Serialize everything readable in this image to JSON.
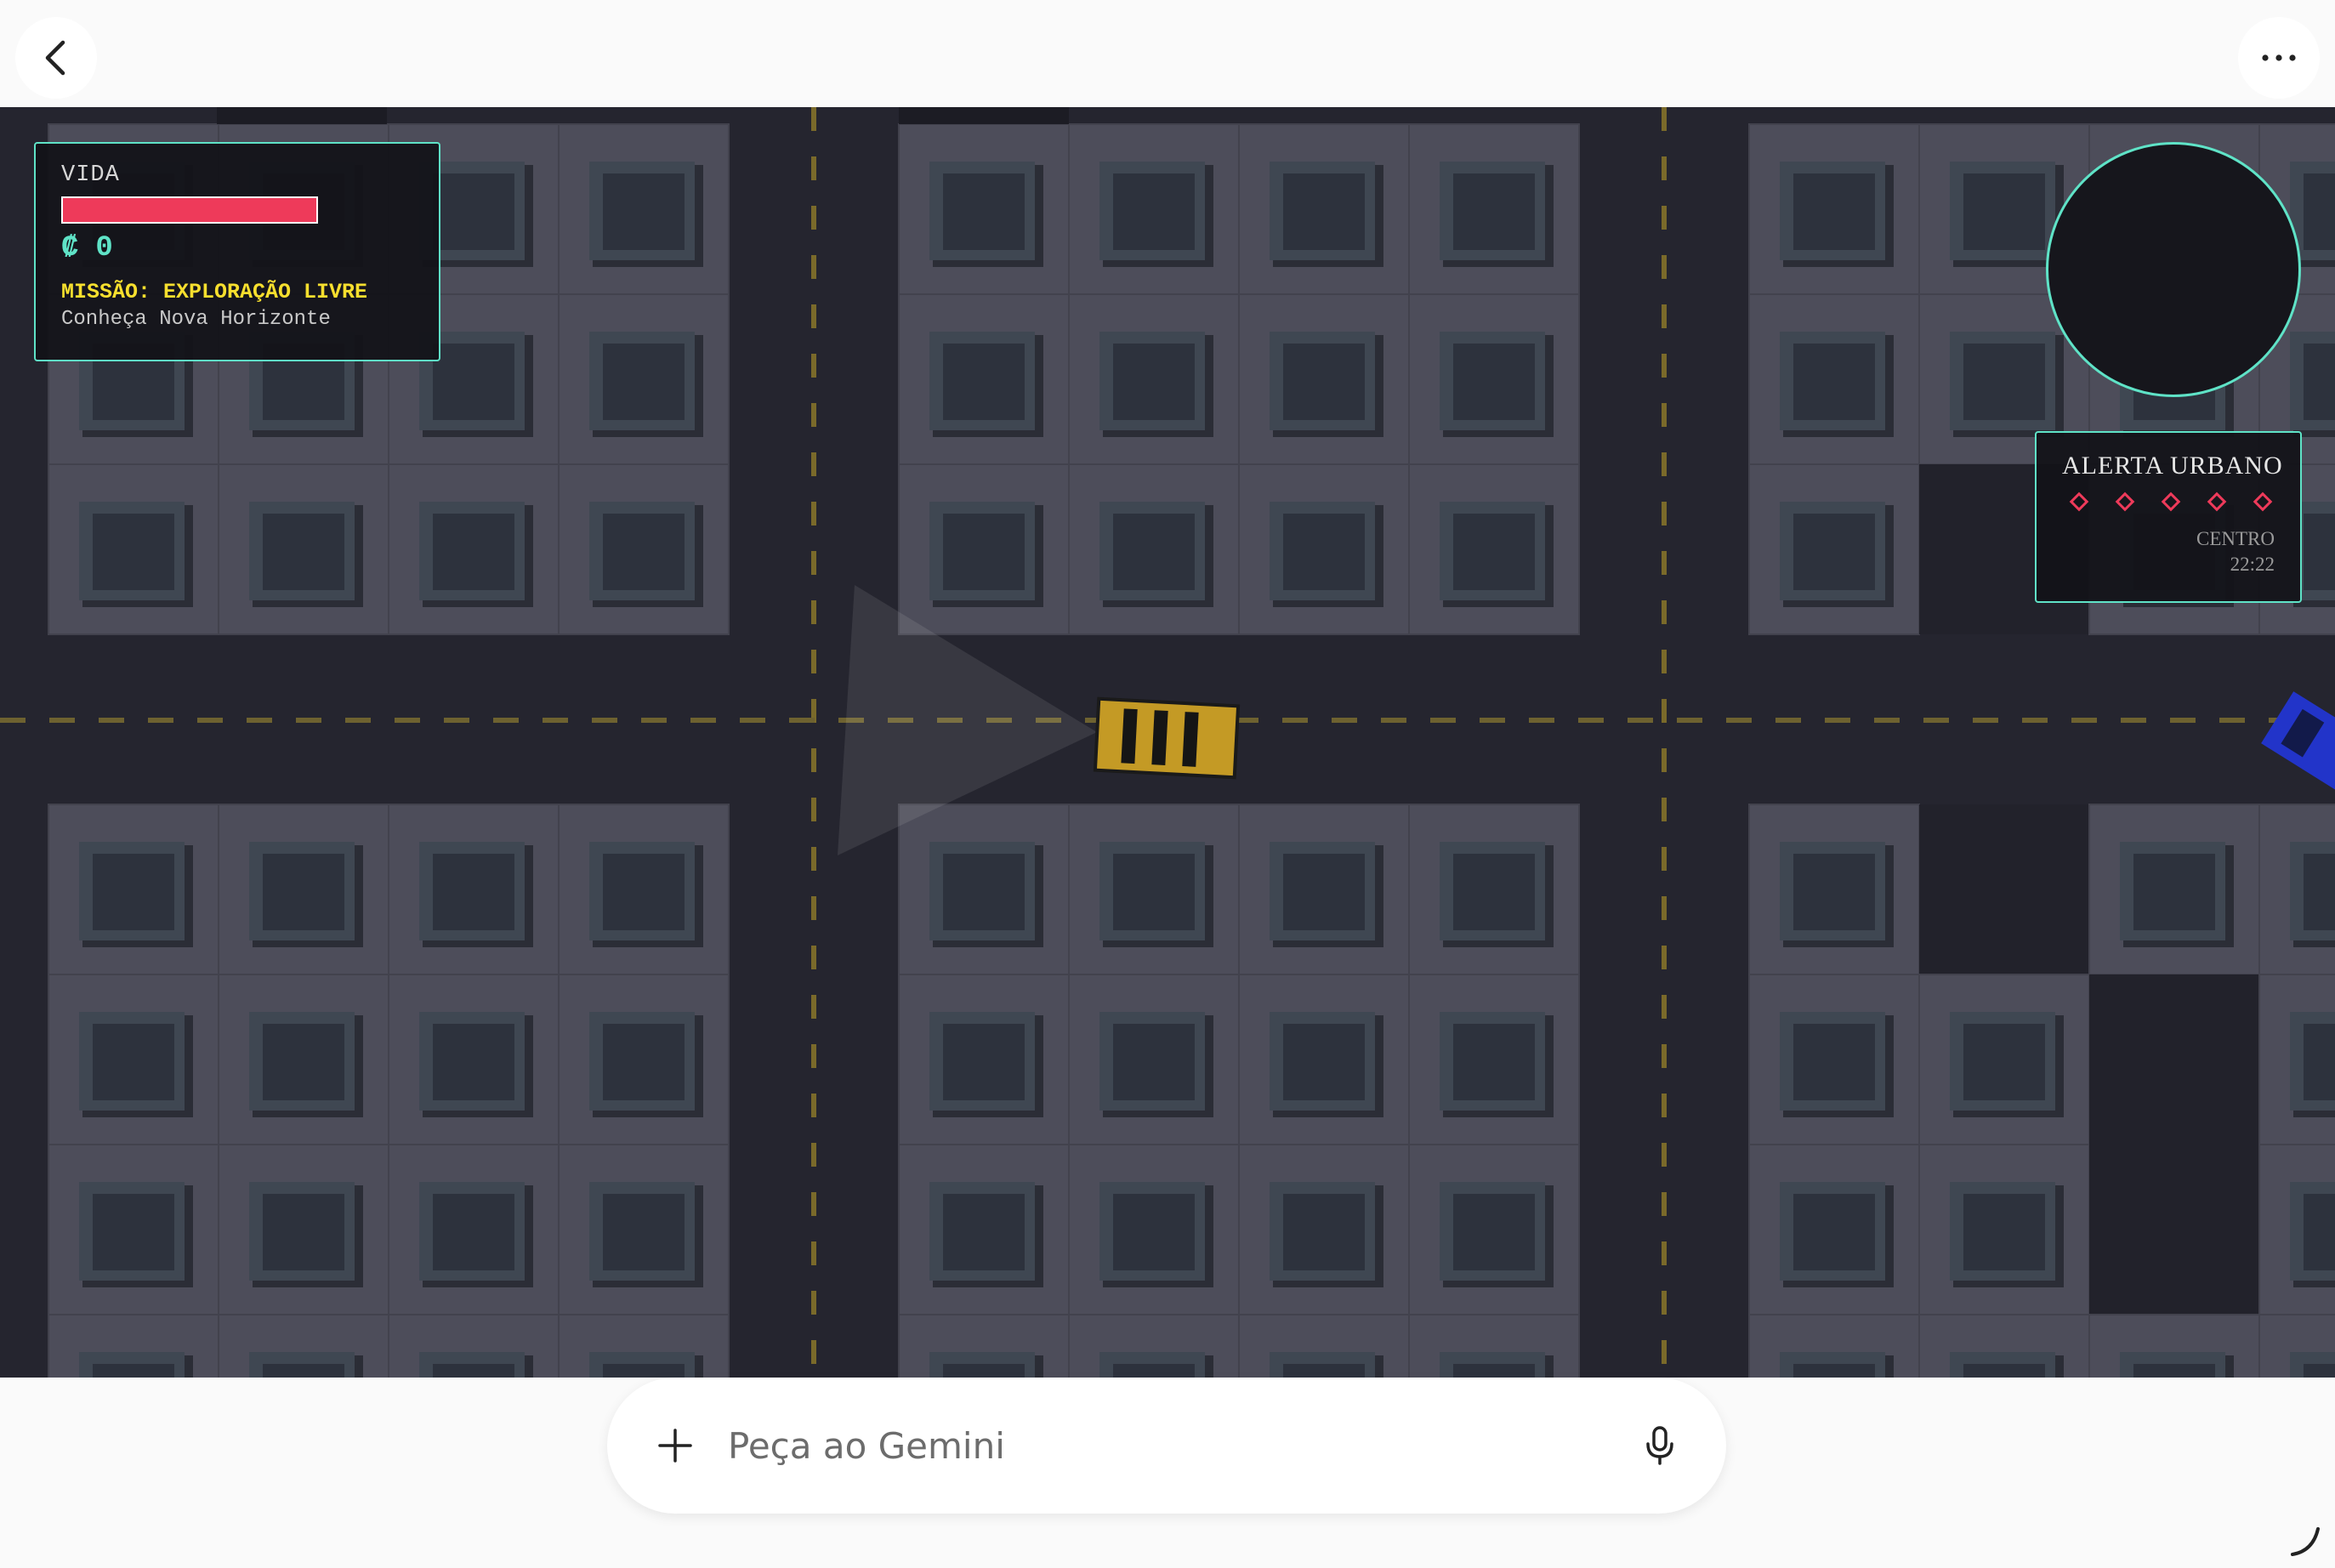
{
  "topbar": {
    "back_icon": "chevron-left-icon",
    "more_icon": "more-horizontal-icon"
  },
  "hud": {
    "life_label": "VIDA",
    "life_level": 1.0,
    "currency_symbol": "₡",
    "money": "0",
    "mission_title": "MISSÃO: EXPLORAÇÃO LIVRE",
    "mission_subtitle": "Conheça Nova Horizonte"
  },
  "alert": {
    "title": "ALERTA URBANO",
    "stars_total": 5,
    "zone": "CENTRO",
    "time": "22:22"
  },
  "prompt": {
    "placeholder": "Peça ao Gemini",
    "plus_icon": "plus-icon",
    "mic_icon": "mic-icon"
  },
  "colors": {
    "accent": "#5fe3c7",
    "life": "#ee3a5a",
    "mission": "#f7df2e",
    "road": "#25252f",
    "block": "#4d4d5a",
    "taxi": "#c49a25",
    "enemy_car": "#2234c9"
  }
}
